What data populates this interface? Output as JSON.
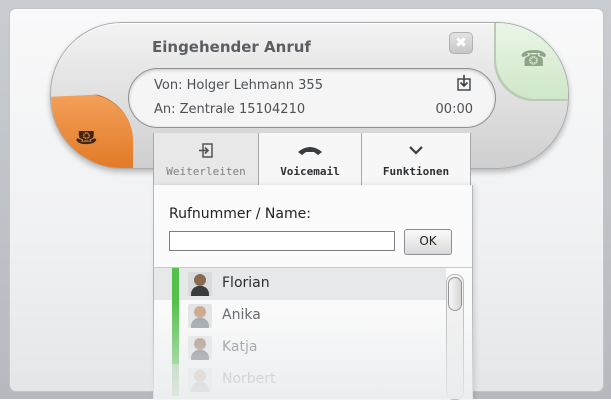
{
  "call": {
    "title": "Eingehender Anruf",
    "from": "Von: Holger Lehmann 355",
    "to": "An:  Zentrale  15104210",
    "duration": "00:00",
    "close_glyph": "✖",
    "colors": {
      "reject": "#e8843a",
      "accept": "#d6ebd0"
    }
  },
  "actions": {
    "forward": {
      "label": "Weiterleiten",
      "icon": "forward-icon"
    },
    "voicemail": {
      "label": "Voicemail",
      "icon": "voicemail-icon"
    },
    "functions": {
      "label": "Funktionen",
      "icon": "chevron-down-icon"
    }
  },
  "forward_panel": {
    "label": "Rufnummer / Name:",
    "input_value": "",
    "ok_label": "OK",
    "contacts": [
      {
        "name": "Florian",
        "status_color": "#54c14a",
        "selected": true
      },
      {
        "name": "Anika",
        "status_color": "#54c14a",
        "selected": false
      },
      {
        "name": "Katja",
        "status_color": "#54c14a",
        "selected": false
      },
      {
        "name": "Norbert",
        "status_color": "#9fd39a",
        "selected": false
      }
    ]
  }
}
